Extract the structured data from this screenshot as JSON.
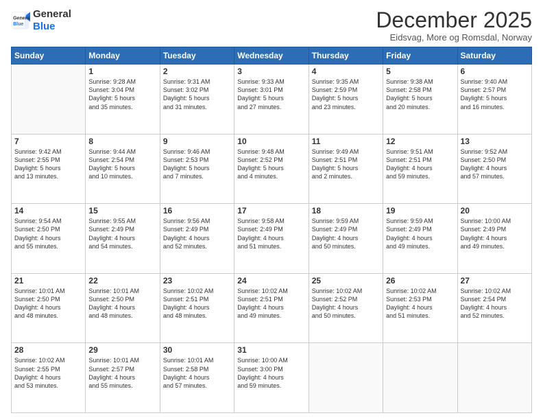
{
  "logo": {
    "line1": "General",
    "line2": "Blue"
  },
  "title": "December 2025",
  "subtitle": "Eidsvag, More og Romsdal, Norway",
  "weekdays": [
    "Sunday",
    "Monday",
    "Tuesday",
    "Wednesday",
    "Thursday",
    "Friday",
    "Saturday"
  ],
  "weeks": [
    [
      {
        "day": "",
        "info": ""
      },
      {
        "day": "1",
        "info": "Sunrise: 9:28 AM\nSunset: 3:04 PM\nDaylight: 5 hours\nand 35 minutes."
      },
      {
        "day": "2",
        "info": "Sunrise: 9:31 AM\nSunset: 3:02 PM\nDaylight: 5 hours\nand 31 minutes."
      },
      {
        "day": "3",
        "info": "Sunrise: 9:33 AM\nSunset: 3:01 PM\nDaylight: 5 hours\nand 27 minutes."
      },
      {
        "day": "4",
        "info": "Sunrise: 9:35 AM\nSunset: 2:59 PM\nDaylight: 5 hours\nand 23 minutes."
      },
      {
        "day": "5",
        "info": "Sunrise: 9:38 AM\nSunset: 2:58 PM\nDaylight: 5 hours\nand 20 minutes."
      },
      {
        "day": "6",
        "info": "Sunrise: 9:40 AM\nSunset: 2:57 PM\nDaylight: 5 hours\nand 16 minutes."
      }
    ],
    [
      {
        "day": "7",
        "info": "Sunrise: 9:42 AM\nSunset: 2:55 PM\nDaylight: 5 hours\nand 13 minutes."
      },
      {
        "day": "8",
        "info": "Sunrise: 9:44 AM\nSunset: 2:54 PM\nDaylight: 5 hours\nand 10 minutes."
      },
      {
        "day": "9",
        "info": "Sunrise: 9:46 AM\nSunset: 2:53 PM\nDaylight: 5 hours\nand 7 minutes."
      },
      {
        "day": "10",
        "info": "Sunrise: 9:48 AM\nSunset: 2:52 PM\nDaylight: 5 hours\nand 4 minutes."
      },
      {
        "day": "11",
        "info": "Sunrise: 9:49 AM\nSunset: 2:51 PM\nDaylight: 5 hours\nand 2 minutes."
      },
      {
        "day": "12",
        "info": "Sunrise: 9:51 AM\nSunset: 2:51 PM\nDaylight: 4 hours\nand 59 minutes."
      },
      {
        "day": "13",
        "info": "Sunrise: 9:52 AM\nSunset: 2:50 PM\nDaylight: 4 hours\nand 57 minutes."
      }
    ],
    [
      {
        "day": "14",
        "info": "Sunrise: 9:54 AM\nSunset: 2:50 PM\nDaylight: 4 hours\nand 55 minutes."
      },
      {
        "day": "15",
        "info": "Sunrise: 9:55 AM\nSunset: 2:49 PM\nDaylight: 4 hours\nand 54 minutes."
      },
      {
        "day": "16",
        "info": "Sunrise: 9:56 AM\nSunset: 2:49 PM\nDaylight: 4 hours\nand 52 minutes."
      },
      {
        "day": "17",
        "info": "Sunrise: 9:58 AM\nSunset: 2:49 PM\nDaylight: 4 hours\nand 51 minutes."
      },
      {
        "day": "18",
        "info": "Sunrise: 9:59 AM\nSunset: 2:49 PM\nDaylight: 4 hours\nand 50 minutes."
      },
      {
        "day": "19",
        "info": "Sunrise: 9:59 AM\nSunset: 2:49 PM\nDaylight: 4 hours\nand 49 minutes."
      },
      {
        "day": "20",
        "info": "Sunrise: 10:00 AM\nSunset: 2:49 PM\nDaylight: 4 hours\nand 49 minutes."
      }
    ],
    [
      {
        "day": "21",
        "info": "Sunrise: 10:01 AM\nSunset: 2:50 PM\nDaylight: 4 hours\nand 48 minutes."
      },
      {
        "day": "22",
        "info": "Sunrise: 10:01 AM\nSunset: 2:50 PM\nDaylight: 4 hours\nand 48 minutes."
      },
      {
        "day": "23",
        "info": "Sunrise: 10:02 AM\nSunset: 2:51 PM\nDaylight: 4 hours\nand 48 minutes."
      },
      {
        "day": "24",
        "info": "Sunrise: 10:02 AM\nSunset: 2:51 PM\nDaylight: 4 hours\nand 49 minutes."
      },
      {
        "day": "25",
        "info": "Sunrise: 10:02 AM\nSunset: 2:52 PM\nDaylight: 4 hours\nand 50 minutes."
      },
      {
        "day": "26",
        "info": "Sunrise: 10:02 AM\nSunset: 2:53 PM\nDaylight: 4 hours\nand 51 minutes."
      },
      {
        "day": "27",
        "info": "Sunrise: 10:02 AM\nSunset: 2:54 PM\nDaylight: 4 hours\nand 52 minutes."
      }
    ],
    [
      {
        "day": "28",
        "info": "Sunrise: 10:02 AM\nSunset: 2:55 PM\nDaylight: 4 hours\nand 53 minutes."
      },
      {
        "day": "29",
        "info": "Sunrise: 10:01 AM\nSunset: 2:57 PM\nDaylight: 4 hours\nand 55 minutes."
      },
      {
        "day": "30",
        "info": "Sunrise: 10:01 AM\nSunset: 2:58 PM\nDaylight: 4 hours\nand 57 minutes."
      },
      {
        "day": "31",
        "info": "Sunrise: 10:00 AM\nSunset: 3:00 PM\nDaylight: 4 hours\nand 59 minutes."
      },
      {
        "day": "",
        "info": ""
      },
      {
        "day": "",
        "info": ""
      },
      {
        "day": "",
        "info": ""
      }
    ]
  ]
}
